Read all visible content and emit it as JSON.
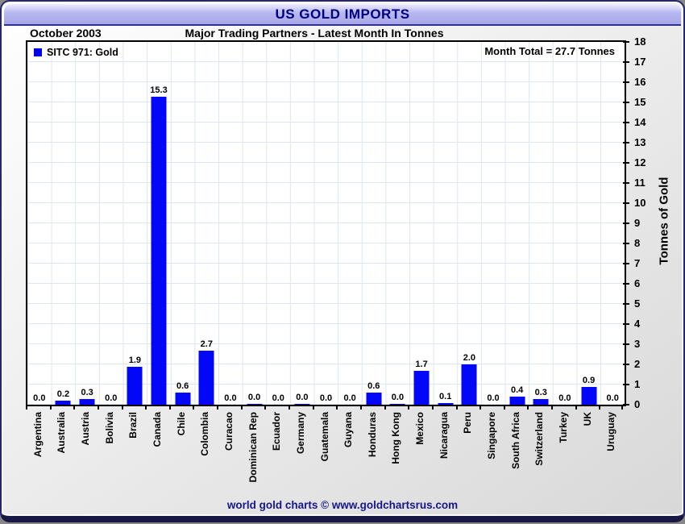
{
  "window": {
    "title": "US GOLD IMPORTS",
    "footer": "world gold charts © www.goldchartsrus.com"
  },
  "header": {
    "date": "October 2003",
    "subtitle": "Major Trading Partners - Latest Month In Tonnes"
  },
  "legend": {
    "label": "SITC 971: Gold",
    "swatch_color": "#0000e8"
  },
  "annotation": {
    "month_total": "Month Total = 27.7 Tonnes"
  },
  "chart_data": {
    "type": "bar",
    "title": "US GOLD IMPORTS",
    "subtitle": "Major Trading Partners - Latest Month In Tonnes",
    "period": "October 2003",
    "categories": [
      "Argentina",
      "Australia",
      "Austria",
      "Bolivia",
      "Brazil",
      "Canada",
      "Chile",
      "Colombia",
      "Curacao",
      "Dominican Rep",
      "Ecuador",
      "Germany",
      "Guatemala",
      "Guyana",
      "Honduras",
      "Hong Kong",
      "Mexico",
      "Nicaragua",
      "Peru",
      "Singapore",
      "South Africa",
      "Switzerland",
      "Turkey",
      "UK",
      "Uruguay"
    ],
    "values": [
      0.0,
      0.2,
      0.3,
      0.0,
      1.9,
      15.3,
      0.6,
      2.7,
      0.0,
      0.04,
      0.0,
      0.04,
      0.0,
      0.0,
      0.6,
      0.04,
      1.7,
      0.1,
      2.0,
      0.0,
      0.4,
      0.3,
      0.0,
      0.9,
      0.0
    ],
    "value_labels": [
      "0.0",
      "0.2",
      "0.3",
      "0.0",
      "1.9",
      "15.3",
      "0.6",
      "2.7",
      "0.0",
      "0.0",
      "0.0",
      "0.0",
      "0.0",
      "0.0",
      "0.6",
      "0.0",
      "1.7",
      "0.1",
      "2.0",
      "0.0",
      "0.4",
      "0.3",
      "0.0",
      "0.9",
      "0.0"
    ],
    "series_name": "SITC 971: Gold",
    "month_total_tonnes": 27.7,
    "xlabel": "",
    "ylabel": "Tonnes of Gold",
    "ylim": [
      0,
      18
    ],
    "ytick_step": 1,
    "grid": true,
    "legend_position": "top-left",
    "bar_color": "#0207f8"
  }
}
